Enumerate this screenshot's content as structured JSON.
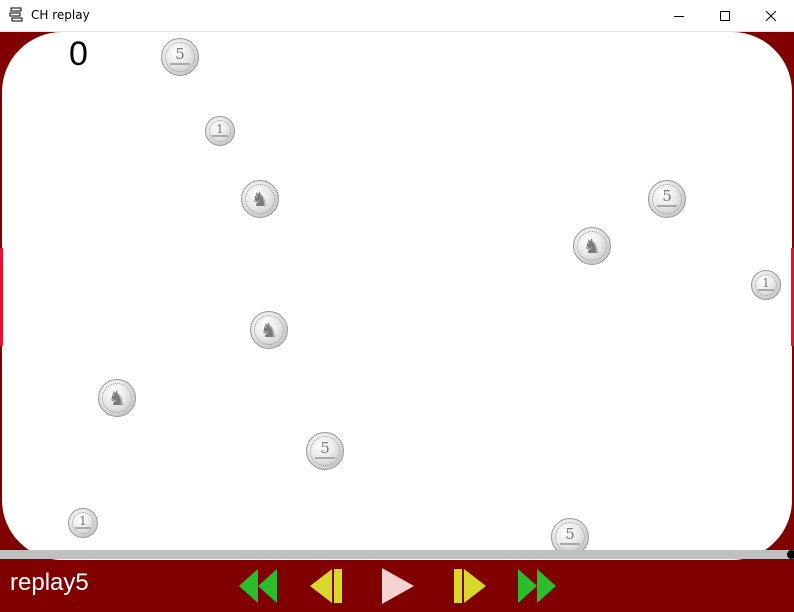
{
  "window": {
    "title": "CH replay",
    "app_icon": "app-icon",
    "buttons": [
      "minimize-icon",
      "maximize-icon",
      "close-icon"
    ]
  },
  "game": {
    "score": "0",
    "colors": {
      "frame": "#800000",
      "field": "#ffffff",
      "side_bars": "#e8102a",
      "track": "#c0c0c0"
    },
    "coins": [
      {
        "value": "5",
        "face": "numeral"
      },
      {
        "value": "1",
        "face": "numeral"
      },
      {
        "value": "",
        "face": "rider"
      },
      {
        "value": "5",
        "face": "numeral"
      },
      {
        "value": "",
        "face": "rider"
      },
      {
        "value": "1",
        "face": "numeral"
      },
      {
        "value": "",
        "face": "rider"
      },
      {
        "value": "",
        "face": "rider"
      },
      {
        "value": "5",
        "face": "numeral"
      },
      {
        "value": "1",
        "face": "numeral"
      },
      {
        "value": "5",
        "face": "numeral"
      }
    ]
  },
  "replay": {
    "name": "replay5",
    "progress": 1.0,
    "controls": {
      "rewind": {
        "icon": "rewind-icon",
        "color": "#2cbd2c"
      },
      "step_back": {
        "icon": "step-back-icon",
        "color": "#d8d82a"
      },
      "play": {
        "icon": "play-icon",
        "color": "#f6d3d3"
      },
      "step_forward": {
        "icon": "step-forward-icon",
        "color": "#d8d82a"
      },
      "fast_forward": {
        "icon": "fast-forward-icon",
        "color": "#2cbd2c"
      }
    }
  }
}
